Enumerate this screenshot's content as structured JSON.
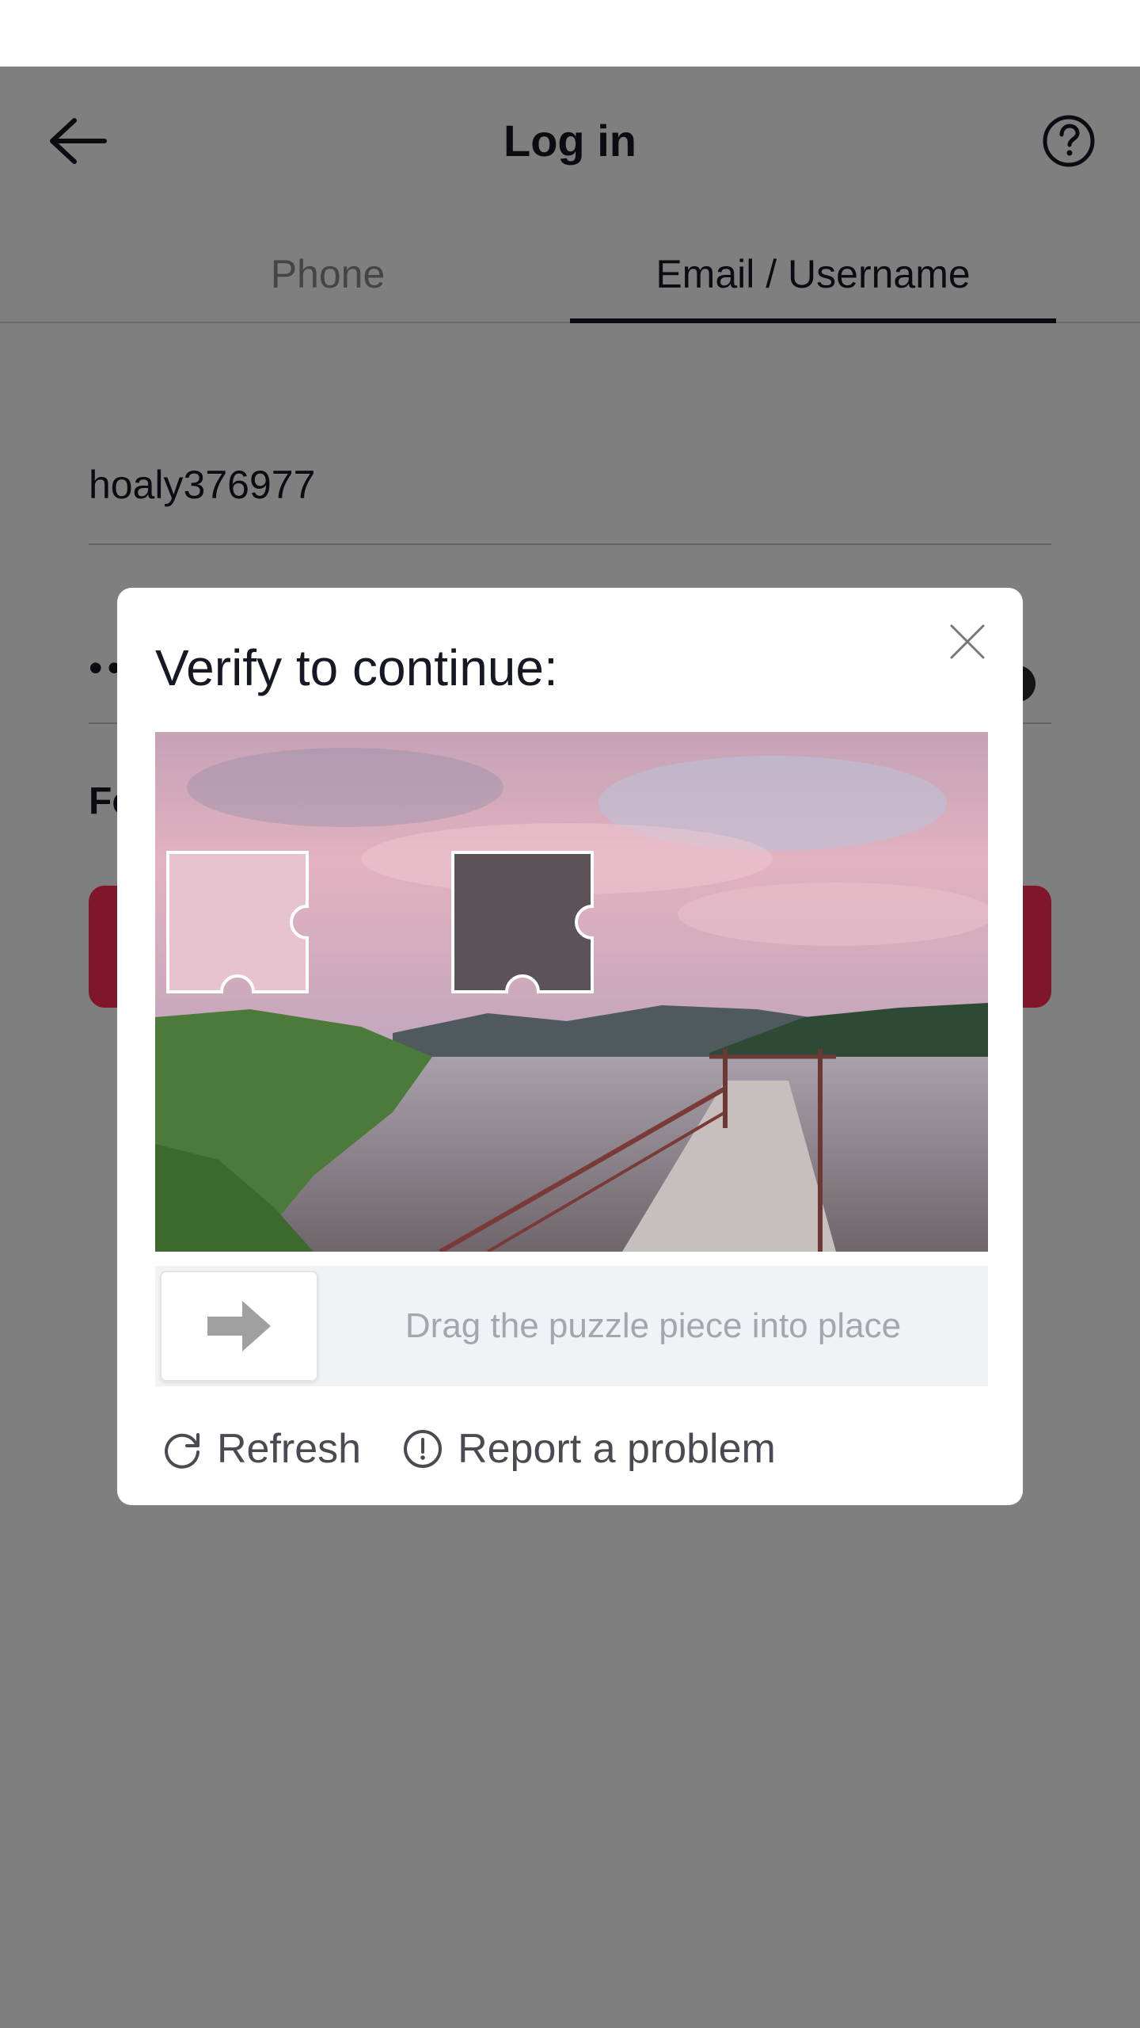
{
  "header": {
    "back_icon": "arrow-left-icon",
    "title": "Log in",
    "help_icon": "question-circle-icon"
  },
  "tabs": [
    {
      "label": "Phone",
      "active": false
    },
    {
      "label": "Email / Username",
      "active": true
    }
  ],
  "form": {
    "username_value": "hoaly376977",
    "password_masked": "••",
    "forgot_partial": "Fo",
    "login_button_color": "#fe2c55"
  },
  "captcha": {
    "title": "Verify to continue:",
    "close_icon": "close-icon",
    "image": "lake-pier-sunset-photo",
    "slider_hint": "Drag the puzzle piece into place",
    "slider_icon": "arrow-right-icon",
    "refresh_label": "Refresh",
    "refresh_icon": "refresh-icon",
    "report_label": "Report a problem",
    "report_icon": "exclamation-circle-icon"
  },
  "colors": {
    "overlay": "rgba(0,0,0,0.5)",
    "text": "#161823",
    "muted": "#8a8b91",
    "accent": "#fe2c55"
  }
}
